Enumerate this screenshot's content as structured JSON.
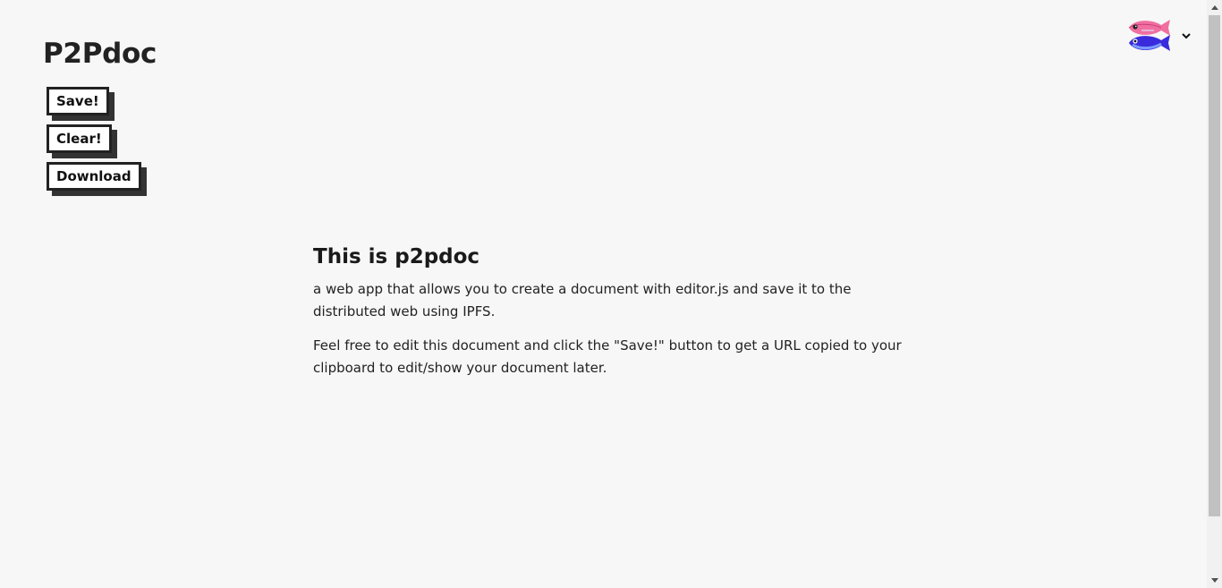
{
  "app": {
    "title": "P2Pdoc"
  },
  "toolbar": {
    "save_label": "Save!",
    "clear_label": "Clear!",
    "download_label": "Download"
  },
  "user_menu": {
    "avatar_icon": "fish-avatar-icon",
    "dropdown_icon": "chevron-down-icon"
  },
  "document": {
    "heading": "This is p2pdoc",
    "paragraphs": [
      "a web app that allows you to create a document with editor.js and save it to the distributed web using IPFS.",
      "Feel free to edit this document and click the \"Save!\" button to get a URL copied to your clipboard to edit/show your document later."
    ]
  },
  "colors": {
    "background": "#f7f7f7",
    "button_border": "#222222",
    "button_shadow": "#333333",
    "fish_pink": "#f06fa0",
    "fish_blue": "#3a2bdc"
  }
}
